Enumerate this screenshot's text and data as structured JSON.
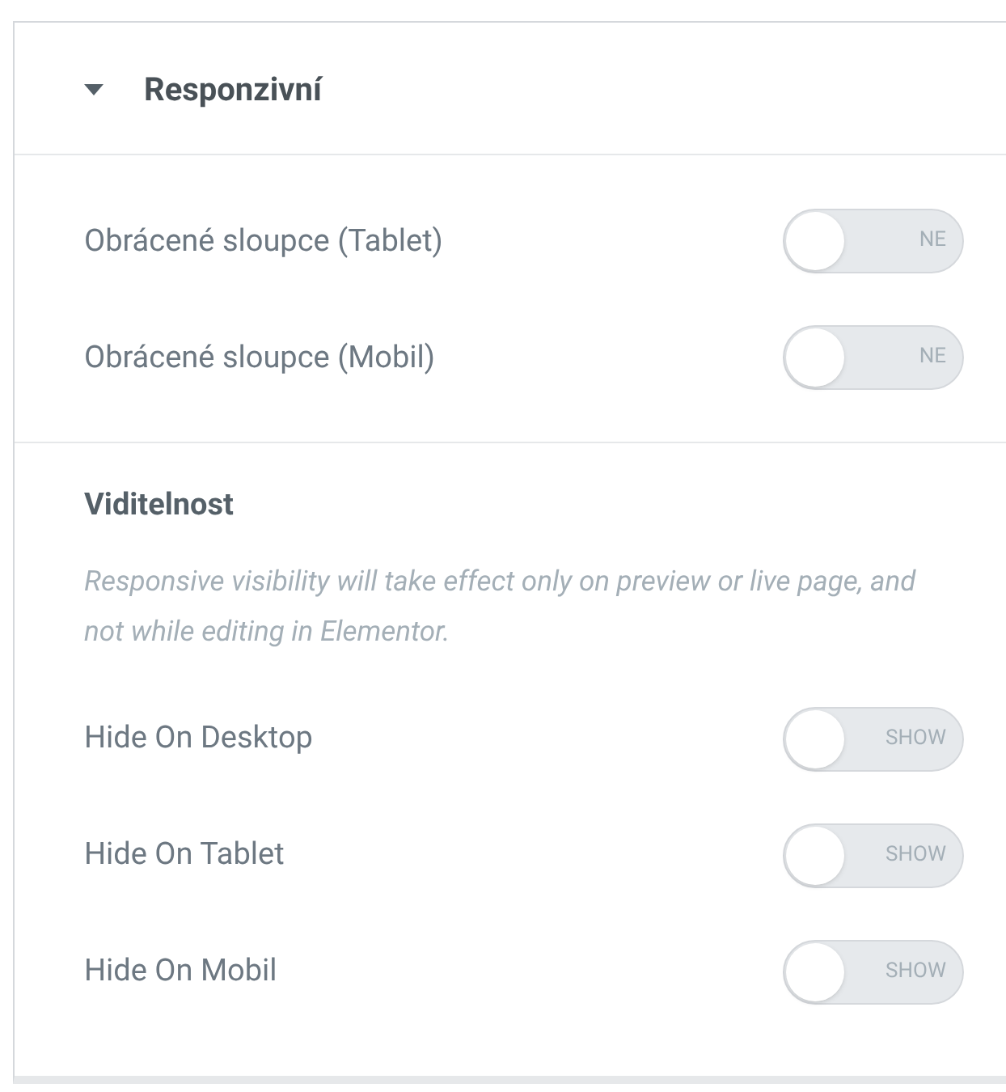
{
  "section": {
    "title": "Responzivní",
    "expanded": true
  },
  "reverse_rows": [
    {
      "label": "Obrácené sloupce (Tablet)",
      "on": false,
      "switch_text": "NE"
    },
    {
      "label": "Obrácené sloupce (Mobil)",
      "on": false,
      "switch_text": "NE"
    }
  ],
  "visibility": {
    "heading": "Viditelnost",
    "note": "Responsive visibility will take effect only on preview or live page, and not while editing in Elementor.",
    "rows": [
      {
        "label": "Hide On Desktop",
        "on": false,
        "switch_text": "SHOW"
      },
      {
        "label": "Hide On Tablet",
        "on": false,
        "switch_text": "SHOW"
      },
      {
        "label": "Hide On Mobil",
        "on": false,
        "switch_text": "SHOW"
      }
    ]
  }
}
